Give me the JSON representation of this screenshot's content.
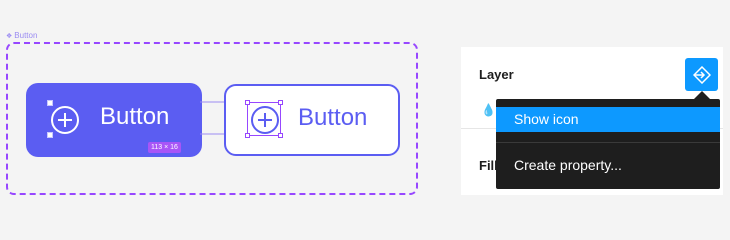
{
  "canvas": {
    "component_set_label": "Button",
    "buttons": [
      {
        "label": "Button",
        "variant": "filled",
        "size_badge": "113 × 16"
      },
      {
        "label": "Button",
        "variant": "outline"
      }
    ],
    "colors": {
      "primary": "#5b5df2",
      "selection": "#9747ff",
      "badge": "#a855f7"
    }
  },
  "panel": {
    "layer_title": "Layer",
    "fill_title": "Fill",
    "property_button_icon": "apply-variable-icon",
    "menu": {
      "items": [
        "Show icon",
        "Create property..."
      ],
      "highlighted": "Show icon"
    },
    "colors": {
      "accent": "#0d99ff",
      "menu_bg": "#1e1e1e"
    }
  }
}
